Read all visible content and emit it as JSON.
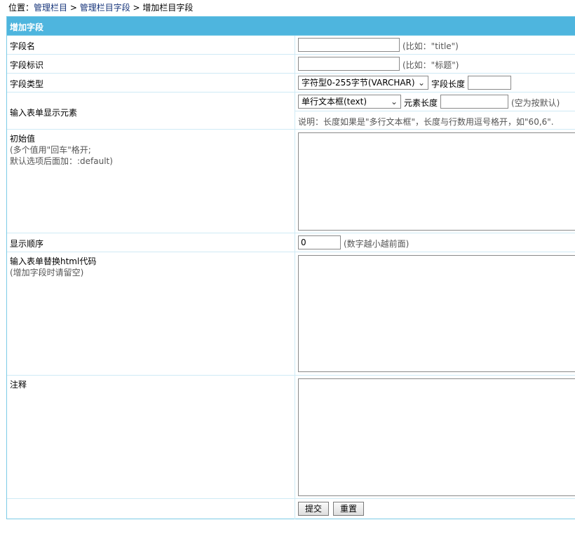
{
  "breadcrumb": {
    "prefix": "位置：",
    "link1": "管理栏目",
    "sep1": " > ",
    "link2": "管理栏目字段",
    "sep2": " > ",
    "current": "增加栏目字段"
  },
  "panel": {
    "title": "增加字段"
  },
  "fields": {
    "name": {
      "label": "字段名",
      "value": "",
      "hint": "(比如：\"title\")"
    },
    "ident": {
      "label": "字段标识",
      "value": "",
      "hint": "(比如：\"标题\")"
    },
    "type": {
      "label": "字段类型",
      "selected": "字符型0-255字节(VARCHAR)",
      "length_label": "字段长度",
      "length_value": ""
    },
    "element": {
      "label": "输入表单显示元素",
      "selected": "单行文本框(text)",
      "length_label": "元素长度",
      "length_value": "",
      "length_hint": "(空为按默认)",
      "note": "说明：长度如果是\"多行文本框\"，长度与行数用逗号格开，如\"60,6\"."
    },
    "default": {
      "label": "初始值",
      "sub1": "(多个值用\"回车\"格开;",
      "sub2": "默认选项后面加：:default)",
      "value": ""
    },
    "order": {
      "label": "显示顺序",
      "value": "0",
      "hint": "(数字越小越前面)"
    },
    "html": {
      "label": "输入表单替换html代码",
      "sub": "(增加字段时请留空)",
      "value": ""
    },
    "comment": {
      "label": "注释",
      "value": ""
    }
  },
  "buttons": {
    "submit": "提交",
    "reset": "重置"
  },
  "colors": {
    "header_bg": "#4eb5de",
    "border": "#7ccbe6",
    "link": "#14337a"
  }
}
